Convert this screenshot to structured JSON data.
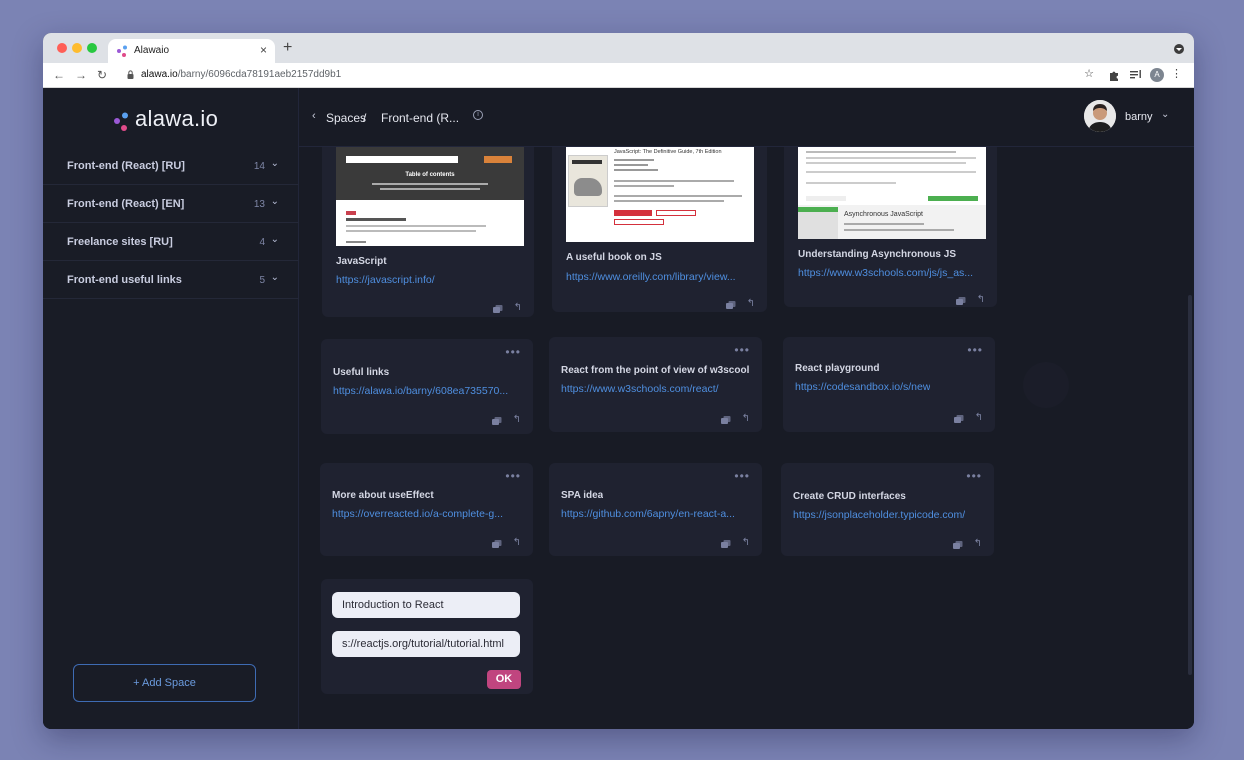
{
  "browser": {
    "tab_title": "Alawaio",
    "tab_close": "×",
    "new_tab": "+",
    "back": "←",
    "forward": "→",
    "reload": "↻",
    "url_host": "alawa.io",
    "url_path": "/barny/6096cda78191aeb2157dd9b1",
    "star": "☆",
    "profile_initial": "A",
    "menu_dots": "⋮"
  },
  "logo": {
    "text": "alawa.io"
  },
  "sidebar": {
    "items": [
      {
        "label": "Front-end (React) [RU]",
        "count": "14"
      },
      {
        "label": "Front-end (React) [EN]",
        "count": "13"
      },
      {
        "label": "Freelance sites [RU]",
        "count": "4"
      },
      {
        "label": "Front-end useful links",
        "count": "5"
      }
    ],
    "add_button": "+ Add Space"
  },
  "topbar": {
    "back": "‹",
    "spaces": "Spaces",
    "separator": "/",
    "current": "Front-end (R...",
    "info": "i",
    "user": "barny"
  },
  "cards": [
    {
      "title": "JavaScript",
      "link": "https://javascript.info/"
    },
    {
      "title": "A useful book on JS",
      "link": "https://www.oreilly.com/library/view..."
    },
    {
      "title": "Understanding Asynchronous JS",
      "link": "https://www.w3schools.com/js/js_as..."
    },
    {
      "title": "Useful links",
      "link": "https://alawa.io/barny/608ea735570..."
    },
    {
      "title": "React from the point of view of w3scool",
      "link": "https://www.w3schools.com/react/"
    },
    {
      "title": "React playground",
      "link": "https://codesandbox.io/s/new"
    },
    {
      "title": "More about useEffect",
      "link": "https://overreacted.io/a-complete-g..."
    },
    {
      "title": "SPA idea",
      "link": "https://github.com/6apny/en-react-a..."
    },
    {
      "title": "Create CRUD interfaces",
      "link": "https://jsonplaceholder.typicode.com/"
    }
  ],
  "thumbs": {
    "js_toc": "Table of contents",
    "book_title": "JavaScript: The Definitive Guide, 7th Edition",
    "async_heading": "Asynchronous JavaScript"
  },
  "new_link_form": {
    "title_value": "Introduction to React",
    "url_value": "s://reactjs.org/tutorial/tutorial.html",
    "ok": "OK"
  },
  "colors": {
    "accent_link": "#4f8fe0",
    "ok_button": "#c0457f",
    "add_space_border": "#3e6bb3"
  }
}
